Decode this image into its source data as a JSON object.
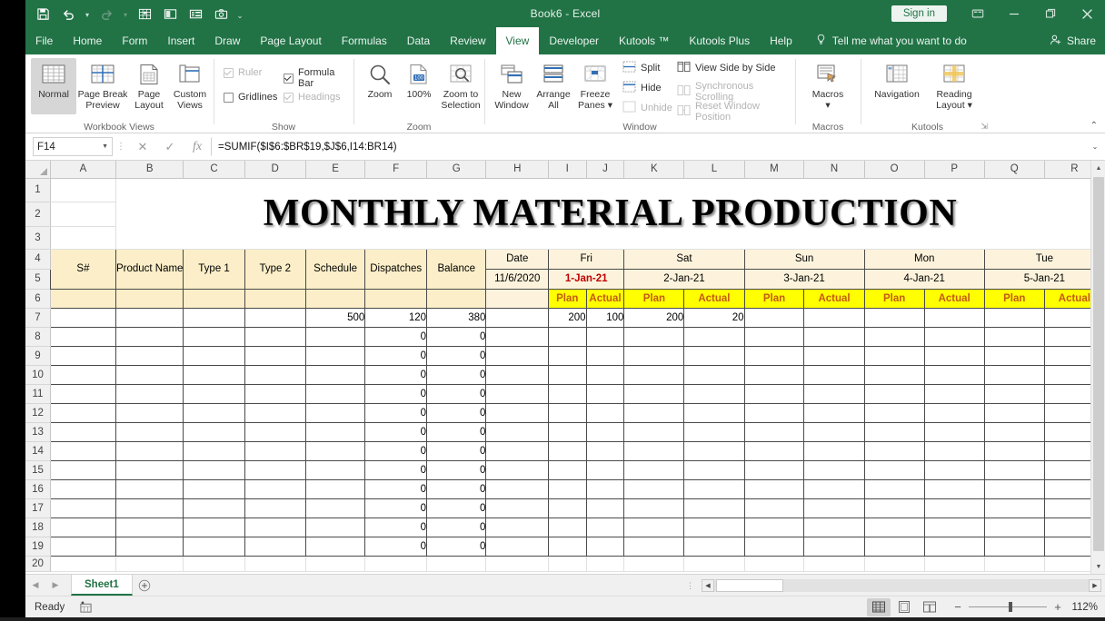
{
  "window": {
    "title": "Book6  -  Excel",
    "signin_label": "Sign in",
    "ribbon_display_icon": "ribbon-display-options-icon",
    "minimize_icon": "minimize-icon",
    "restore_icon": "restore-icon",
    "close_icon": "close-icon"
  },
  "quick_access": [
    {
      "name": "save-icon",
      "label": "Save"
    },
    {
      "name": "undo-icon",
      "label": "Undo"
    },
    {
      "name": "redo-icon",
      "label": "Redo"
    },
    {
      "name": "kutools-icon",
      "label": "Kutools"
    },
    {
      "name": "reading-layout-icon",
      "label": "Reading Layout"
    },
    {
      "name": "form-icon",
      "label": "Form"
    },
    {
      "name": "screenshot-icon",
      "label": "Screenshot"
    },
    {
      "name": "customize-qat-icon",
      "label": "Customize Quick Access Toolbar"
    }
  ],
  "tabs": [
    {
      "label": "File",
      "active": false
    },
    {
      "label": "Home",
      "active": false
    },
    {
      "label": "Form",
      "active": false
    },
    {
      "label": "Insert",
      "active": false
    },
    {
      "label": "Draw",
      "active": false
    },
    {
      "label": "Page Layout",
      "active": false
    },
    {
      "label": "Formulas",
      "active": false
    },
    {
      "label": "Data",
      "active": false
    },
    {
      "label": "Review",
      "active": false
    },
    {
      "label": "View",
      "active": true
    },
    {
      "label": "Developer",
      "active": false
    },
    {
      "label": "Kutools ™",
      "active": false
    },
    {
      "label": "Kutools Plus",
      "active": false
    },
    {
      "label": "Help",
      "active": false
    }
  ],
  "tellme": "Tell me what you want to do",
  "share": "Share",
  "ribbon": {
    "groups": [
      {
        "label": "Workbook Views"
      },
      {
        "label": "Show"
      },
      {
        "label": "Zoom"
      },
      {
        "label": "Window"
      },
      {
        "label": "Macros"
      },
      {
        "label": "Kutools"
      }
    ],
    "workbook_views": [
      {
        "label": "Normal",
        "selected": true
      },
      {
        "label": "Page Break\nPreview",
        "selected": false
      },
      {
        "label": "Page\nLayout",
        "selected": false
      },
      {
        "label": "Custom\nViews",
        "selected": false
      }
    ],
    "show": [
      {
        "label": "Ruler",
        "checked": true,
        "disabled": true
      },
      {
        "label": "Formula Bar",
        "checked": true,
        "disabled": false
      },
      {
        "label": "Gridlines",
        "checked": false,
        "disabled": false
      },
      {
        "label": "Headings",
        "checked": true,
        "disabled": true
      }
    ],
    "zoom": [
      {
        "label": "Zoom"
      },
      {
        "label": "100%"
      },
      {
        "label": "Zoom to\nSelection"
      }
    ],
    "window_big": [
      {
        "label": "New\nWindow"
      },
      {
        "label": "Arrange\nAll"
      },
      {
        "label": "Freeze\nPanes ▾"
      }
    ],
    "window_small": [
      {
        "label": "Split",
        "disabled": false
      },
      {
        "label": "Hide",
        "disabled": false
      },
      {
        "label": "Unhide",
        "disabled": true
      },
      {
        "label": "View Side by Side",
        "disabled": false
      },
      {
        "label": "Synchronous Scrolling",
        "disabled": true
      },
      {
        "label": "Reset Window Position",
        "disabled": true
      }
    ],
    "macros": [
      {
        "label": "Macros\n▾"
      }
    ],
    "kutools": [
      {
        "label": "Navigation"
      },
      {
        "label": "Reading\nLayout ▾"
      }
    ]
  },
  "formula_bar": {
    "name_box": "F14",
    "cancel_icon": "cancel-icon",
    "enter_icon": "enter-icon",
    "function_icon": "insert-function-icon",
    "formula": "=SUMIF($I$6:$BR$19,$J$6,I14:BR14)"
  },
  "grid": {
    "columns": [
      "A",
      "B",
      "C",
      "D",
      "E",
      "F",
      "G",
      "H",
      "I",
      "J",
      "K",
      "L",
      "M",
      "N",
      "O",
      "P",
      "Q",
      "R"
    ],
    "rows": [
      "1",
      "2",
      "3",
      "4",
      "5",
      "6",
      "7",
      "8",
      "9",
      "10",
      "11",
      "12",
      "13",
      "14",
      "15",
      "16",
      "17",
      "18",
      "19",
      "20"
    ],
    "title": "MONTHLY MATERIAL PRODUCTION",
    "headers": {
      "sn": "S#",
      "product_name": "Product Name",
      "type1": "Type 1",
      "type2": "Type 2",
      "schedule": "Schedule",
      "dispatches": "Dispatches",
      "balance": "Balance",
      "date": "Date",
      "date_value": "11/6/2020"
    },
    "days": [
      {
        "weekday": "Fri",
        "date": "1-Jan-21",
        "highlight": true,
        "plan": "Plan",
        "actual": "Actual",
        "plan_value": "200",
        "actual_value": "100"
      },
      {
        "weekday": "Sat",
        "date": "2-Jan-21",
        "highlight": false,
        "plan": "Plan",
        "actual": "Actual",
        "plan_value": "200",
        "actual_value": "20"
      },
      {
        "weekday": "Sun",
        "date": "3-Jan-21",
        "highlight": false,
        "plan": "Plan",
        "actual": "Actual",
        "plan_value": "",
        "actual_value": ""
      },
      {
        "weekday": "Mon",
        "date": "4-Jan-21",
        "highlight": false,
        "plan": "Plan",
        "actual": "Actual",
        "plan_value": "",
        "actual_value": ""
      },
      {
        "weekday": "Tue",
        "date": "5-Jan-21",
        "highlight": false,
        "plan": "Plan",
        "actual": "Actual",
        "plan_value": "",
        "actual_value": ""
      }
    ],
    "data_rows": [
      {
        "row": "7",
        "sn": "",
        "product": "",
        "type1": "",
        "type2": "",
        "schedule": "500",
        "dispatches": "120",
        "balance": "380"
      },
      {
        "row": "8",
        "sn": "",
        "product": "",
        "type1": "",
        "type2": "",
        "schedule": "",
        "dispatches": "0",
        "balance": "0"
      },
      {
        "row": "9",
        "sn": "",
        "product": "",
        "type1": "",
        "type2": "",
        "schedule": "",
        "dispatches": "0",
        "balance": "0"
      },
      {
        "row": "10",
        "sn": "",
        "product": "",
        "type1": "",
        "type2": "",
        "schedule": "",
        "dispatches": "0",
        "balance": "0"
      },
      {
        "row": "11",
        "sn": "",
        "product": "",
        "type1": "",
        "type2": "",
        "schedule": "",
        "dispatches": "0",
        "balance": "0"
      },
      {
        "row": "12",
        "sn": "",
        "product": "",
        "type1": "",
        "type2": "",
        "schedule": "",
        "dispatches": "0",
        "balance": "0"
      },
      {
        "row": "13",
        "sn": "",
        "product": "",
        "type1": "",
        "type2": "",
        "schedule": "",
        "dispatches": "0",
        "balance": "0"
      },
      {
        "row": "14",
        "sn": "",
        "product": "",
        "type1": "",
        "type2": "",
        "schedule": "",
        "dispatches": "0",
        "balance": "0"
      },
      {
        "row": "15",
        "sn": "",
        "product": "",
        "type1": "",
        "type2": "",
        "schedule": "",
        "dispatches": "0",
        "balance": "0"
      },
      {
        "row": "16",
        "sn": "",
        "product": "",
        "type1": "",
        "type2": "",
        "schedule": "",
        "dispatches": "0",
        "balance": "0"
      },
      {
        "row": "17",
        "sn": "",
        "product": "",
        "type1": "",
        "type2": "",
        "schedule": "",
        "dispatches": "0",
        "balance": "0"
      },
      {
        "row": "18",
        "sn": "",
        "product": "",
        "type1": "",
        "type2": "",
        "schedule": "",
        "dispatches": "0",
        "balance": "0"
      },
      {
        "row": "19",
        "sn": "",
        "product": "",
        "type1": "",
        "type2": "",
        "schedule": "",
        "dispatches": "0",
        "balance": "0"
      }
    ]
  },
  "sheet_tabs": {
    "prev_icon": "previous-sheet-icon",
    "next_icon": "next-sheet-icon",
    "tabs": [
      {
        "label": "Sheet1",
        "active": true
      }
    ],
    "add_label": "+"
  },
  "status": {
    "mode": "Ready",
    "accessibility_icon": "accessibility-checker-icon",
    "views": [
      {
        "name": "normal-view-button",
        "selected": true
      },
      {
        "name": "page-layout-view-button",
        "selected": false
      },
      {
        "name": "page-break-preview-button",
        "selected": false
      }
    ],
    "zoom_out": "−",
    "zoom_in": "+",
    "zoom_level": "112%"
  },
  "colors": {
    "excel_green": "#217346",
    "header_tan": "#fbeec8",
    "highlight_yellow": "#ffff00",
    "plan_actual_text": "#c55a11",
    "red_date": "#c00000"
  }
}
